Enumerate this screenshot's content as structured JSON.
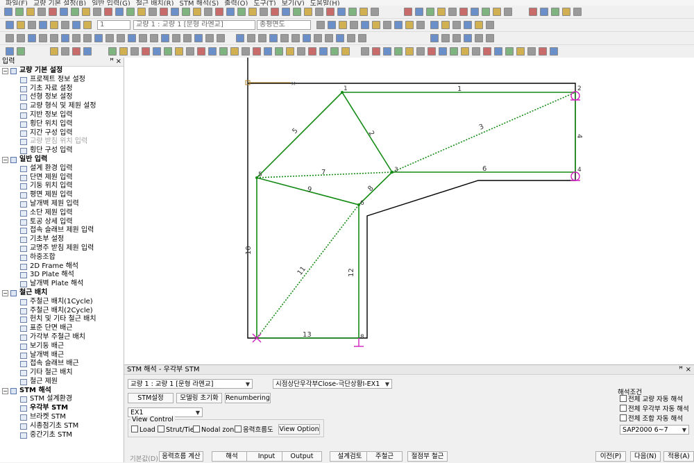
{
  "menubar": {
    "items": [
      "파일(F)",
      "교량 기본 설정(B)",
      "일반 입력(G)",
      "철근 배치(R)",
      "STM 해석(S)",
      "출력(O)",
      "도구(T)",
      "보기(V)",
      "도움말(H)"
    ]
  },
  "toolbar": {
    "combo_bridge_no": "1",
    "combo_bridge": "교량 1 : 교량 1 [문형 라멘교]",
    "combo_view": "종평면도"
  },
  "left_panel": {
    "title": "입력",
    "groups": [
      {
        "label": "교량 기본 설정",
        "items": [
          {
            "label": "프로젝트 정보 설정",
            "enabled": true
          },
          {
            "label": "기초 자료 설정",
            "enabled": true
          },
          {
            "label": "선형 정보 설정",
            "enabled": true
          },
          {
            "label": "교량 형식 및 제원 설정",
            "enabled": true
          },
          {
            "label": "지반 정보 입력",
            "enabled": true
          },
          {
            "label": "횡단 위치 입력",
            "enabled": true
          },
          {
            "label": "지간 구성 입력",
            "enabled": true
          },
          {
            "label": "교량 받침 위치 입력",
            "enabled": false
          },
          {
            "label": "횡단 구성 입력",
            "enabled": true
          }
        ]
      },
      {
        "label": "일반 입력",
        "items": [
          {
            "label": "설계 환경 입력",
            "enabled": true
          },
          {
            "label": "단면 제원 입력",
            "enabled": true
          },
          {
            "label": "기둥 위치 입력",
            "enabled": true
          },
          {
            "label": "평면 제원 입력",
            "enabled": true
          },
          {
            "label": "날개벽 제원 입력",
            "enabled": true
          },
          {
            "label": "소단 제원 입력",
            "enabled": true
          },
          {
            "label": "토공 상세 입력",
            "enabled": true
          },
          {
            "label": "접속 슬래브 제원 입력",
            "enabled": true
          },
          {
            "label": "기초부 설정",
            "enabled": true
          },
          {
            "label": "교명주 받침 제원 입력",
            "enabled": true
          },
          {
            "label": "하중조합",
            "enabled": true
          },
          {
            "label": "2D Frame 해석",
            "enabled": true
          },
          {
            "label": "3D Plate 해석",
            "enabled": true
          },
          {
            "label": "날개벽 Plate 해석",
            "enabled": true
          }
        ]
      },
      {
        "label": "철근 배치",
        "items": [
          {
            "label": "주철근 배치(1Cycle)",
            "enabled": true
          },
          {
            "label": "주철근 배치(2Cycle)",
            "enabled": true
          },
          {
            "label": "헌치 및 기타 철근 배치",
            "enabled": true
          },
          {
            "label": "표준 단면 배근",
            "enabled": true
          },
          {
            "label": "가각부 주철근 배치",
            "enabled": true
          },
          {
            "label": "보기둥 배근",
            "enabled": true
          },
          {
            "label": "날개벽 배근",
            "enabled": true
          },
          {
            "label": "접속 슬래브 배근",
            "enabled": true
          },
          {
            "label": "기타 철근 배치",
            "enabled": true
          },
          {
            "label": "철근 제원",
            "enabled": true
          }
        ]
      },
      {
        "label": "STM 해석",
        "items": [
          {
            "label": "STM 설계환경",
            "enabled": true
          },
          {
            "label": "우각부 STM",
            "enabled": true,
            "selected": true
          },
          {
            "label": "브라켓 STM",
            "enabled": true
          },
          {
            "label": "시종점기초 STM",
            "enabled": true
          },
          {
            "label": "중간기초 STM",
            "enabled": true
          }
        ]
      }
    ]
  },
  "canvas": {
    "nodes": [
      "1",
      "2",
      "3",
      "4",
      "5",
      "6",
      "8"
    ],
    "members": [
      "1",
      "2",
      "3",
      "4",
      "5",
      "6",
      "7",
      "8",
      "9",
      "10",
      "11",
      "12",
      "13"
    ]
  },
  "bottom_panel": {
    "title": "STM 해석 - 우각부 STM",
    "bridge_combo": "교량 1 : 교량 1 [문형 라멘교]",
    "case_combo": "시점상단우각부Close-극단상황Ⅰ-EX1",
    "btn_stm_setting": "STM설정",
    "btn_model_init": "모델링 초기화",
    "btn_renumbering": "Renumbering",
    "case_short_combo": "EX1",
    "view_control_label": "View Control",
    "chk_load": "Load",
    "chk_strut": "Strut/Tie",
    "chk_nodal": "Nodal zone",
    "chk_stress": "응력흐름도",
    "btn_view_option": "View Option",
    "analysis_label": "해석조건",
    "chk_auto_bridge": "전체 교량 자동 해석",
    "chk_auto_corner": "전체 우각부 자동 해석",
    "chk_auto_combo": "전체 조합 자동 해석",
    "solver_combo": "SAP2000 6~7",
    "default_label": "기본값(D)",
    "btn_stress_calc": "응력흐름 계산",
    "btn_analysis": "해석",
    "btn_input": "Input",
    "btn_output": "Output",
    "btn_design_check": "설계검토",
    "btn_main_rebar": "주철근",
    "btn_node_rebar": "절점부 철근",
    "btn_prev": "이전(P)",
    "btn_next": "다음(N)",
    "btn_apply": "적용(A)"
  }
}
